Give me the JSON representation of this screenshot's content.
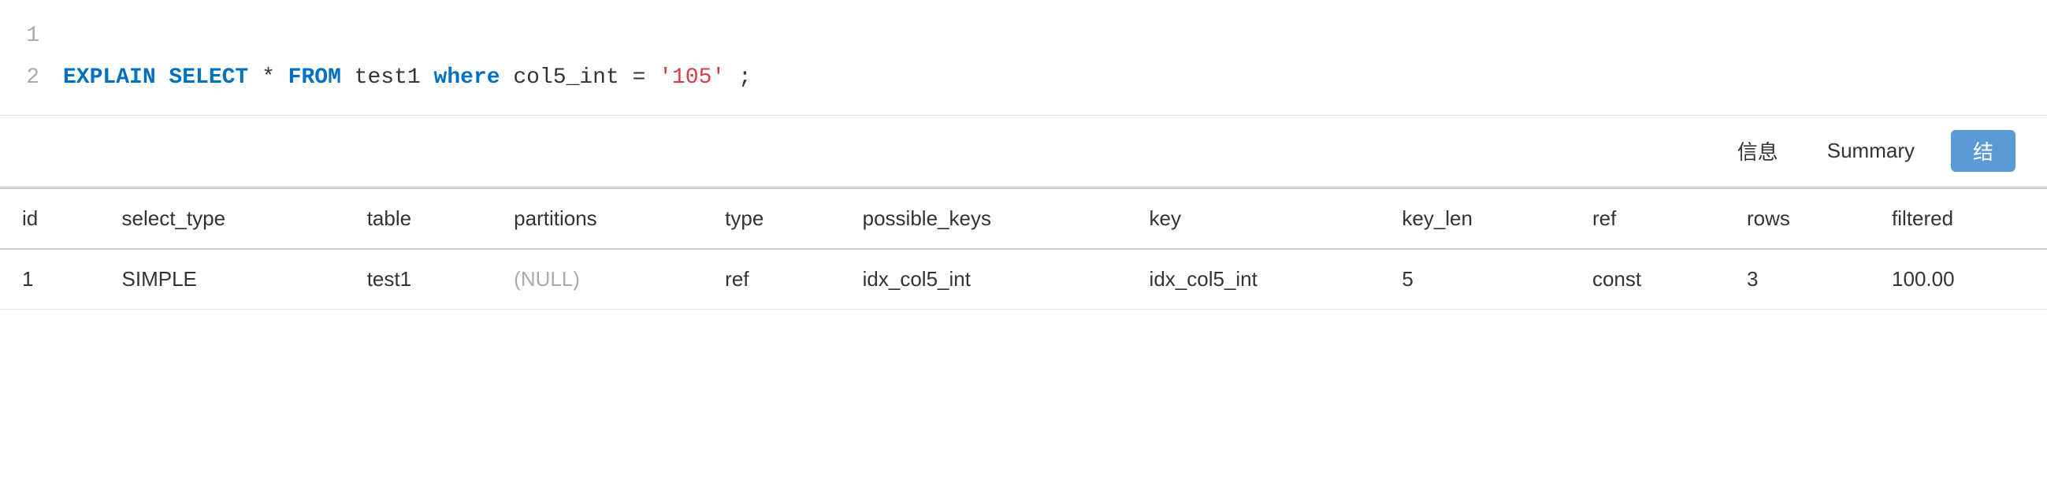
{
  "editor": {
    "lines": [
      {
        "number": "1",
        "content": ""
      },
      {
        "number": "2",
        "content_parts": [
          {
            "text": "EXPLAIN SELECT",
            "style": "kw-blue"
          },
          {
            "text": " * ",
            "style": "kw-plain"
          },
          {
            "text": "FROM",
            "style": "kw-blue"
          },
          {
            "text": " test1 ",
            "style": "kw-plain"
          },
          {
            "text": "where",
            "style": "kw-blue"
          },
          {
            "text": " col5_int = ",
            "style": "kw-plain"
          },
          {
            "text": "'105'",
            "style": "kw-red"
          },
          {
            "text": ";",
            "style": "kw-plain"
          }
        ]
      }
    ]
  },
  "toolbar": {
    "tabs": [
      {
        "label": "信息",
        "active": false
      },
      {
        "label": "Summary",
        "active": false
      },
      {
        "label": "结",
        "active": true
      }
    ]
  },
  "table": {
    "columns": [
      "id",
      "select_type",
      "table",
      "partitions",
      "type",
      "possible_keys",
      "key",
      "key_len",
      "ref",
      "rows",
      "filtered"
    ],
    "rows": [
      {
        "id": "1",
        "select_type": "SIMPLE",
        "table": "test1",
        "partitions": "(NULL)",
        "type": "ref",
        "possible_keys": "idx_col5_int",
        "key": "idx_col5_int",
        "key_len": "5",
        "ref": "const",
        "rows": "3",
        "filtered": "100.00"
      }
    ]
  }
}
